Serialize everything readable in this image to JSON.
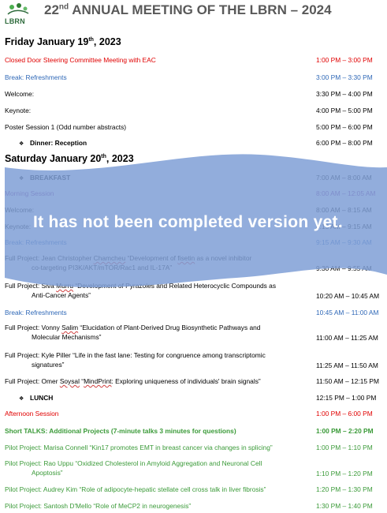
{
  "header": {
    "logo_text": "LBRN",
    "title_pre": "22",
    "title_sup": "nd",
    "title_post": " ANNUAL MEETING OF THE LBRN – 2024"
  },
  "days": [
    {
      "pre": "Friday January 19",
      "sup": "th",
      "post": ", 2023"
    },
    {
      "pre": "Saturday January 20",
      "sup": "th",
      "post": ", 2023"
    }
  ],
  "schedule": {
    "friday": [
      {
        "event": "Closed Door Steering Committee Meeting with EAC",
        "time": "1:00 PM – 3:00 PM"
      },
      {
        "event": "Break: Refreshments",
        "time": "3:00 PM – 3:30 PM"
      },
      {
        "event": "Welcome:",
        "time": "3:30 PM – 4:00 PM"
      },
      {
        "event": "Keynote:",
        "time": "4:00 PM – 5:00 PM"
      },
      {
        "event": "Poster Session 1 (Odd number abstracts)",
        "time": "5:00 PM – 6:00 PM"
      },
      {
        "event": "Dinner: Reception",
        "time": "6:00 PM – 8:00 PM"
      }
    ],
    "saturday": [
      {
        "event": "BREAKFAST",
        "time": "7:00 AM – 8:00 AM"
      },
      {
        "event": "Morning Session",
        "time": "8:00 AM – 12:05 AM"
      },
      {
        "event": "Welcome:",
        "time": "8:00 AM – 8:15 AM"
      },
      {
        "event": "Keynote:",
        "time": "8:15 AM – 9:15 AM"
      },
      {
        "event": "Break: Refreshments",
        "time": "9:15 AM – 9:30 AM"
      },
      {
        "pre": "Full Project: Jean Christopher ",
        "mark": "Chamcheu",
        "mid": " “Development of ",
        "mark2": "fisetin",
        "post": " as a novel inhibitor",
        "line2": "co-targeting PI3K/AKT/mTOR/Rac1 and IL-17A”",
        "time": "9:30 AM – 9:55 AM"
      },
      {
        "pre": "Full Project: Siva ",
        "mark": "Murru",
        "post": " “Development of Pyrazoles and Related Heterocyclic Compounds as",
        "line2": "Anti-Cancer Agents”",
        "time": "10:20 AM – 10:45 AM"
      },
      {
        "event": "Break: Refreshments",
        "time": "10:45 AM – 11:00 AM"
      },
      {
        "pre": "Full Project: Vonny ",
        "mark": "Salim",
        "post": " “Elucidation of Plant-Derived Drug Biosynthetic Pathways and",
        "line2": "Molecular Mechanisms”",
        "time": "11:00 AM – 11:25 AM"
      },
      {
        "event": "Full Project: Kyle Piller “Life in the fast lane: Testing for congruence among transcriptomic",
        "line2": "signatures”",
        "time": "11:25 AM – 11:50 AM"
      },
      {
        "pre": "Full Project: Omer ",
        "mark": "Soysal",
        "mid": " “",
        "mark2": "MindPrint",
        "post": ": Exploring uniqueness of individuals' brain signals”",
        "time": "11:50 AM – 12:15 PM"
      },
      {
        "event": "LUNCH",
        "time": "12:15 PM – 1:00 PM"
      },
      {
        "event": "Afternoon Session",
        "time": "1:00 PM – 6:00 PM"
      },
      {
        "event": "Short TALKS: Additional Projects (7-minute talks 3 minutes for questions)",
        "time": "1:00 PM – 2:20 PM"
      },
      {
        "event": "Pilot Project: Marisa Connell “Kin17 promotes EMT in breast cancer via changes in splicing”",
        "time": "1:00 PM – 1:10 PM"
      },
      {
        "event": "Pilot Project: Rao Uppu “Oxidized Cholesterol in Amyloid Aggregation and Neuronal Cell",
        "line2": "Apoptosis”",
        "time": "1:10 PM – 1:20 PM"
      },
      {
        "event": "Pilot Project: Audrey Kim “Role of adipocyte-hepatic stellate cell cross talk in liver fibrosis”",
        "time": "1:20 PM – 1:30 PM"
      },
      {
        "event": "Pilot Project: Santosh D'Mello “Role of MeCP2 in neurogenesis”",
        "time": "1:30 PM – 1:40 PM"
      }
    ]
  },
  "watermark": "It has not been completed version yet.",
  "colors": {
    "red": "#e00000",
    "blue": "#2f68b7",
    "purple": "#7a2a8a",
    "green": "#3a9a38",
    "overlay": "#7f9fd6",
    "title": "#595959"
  }
}
